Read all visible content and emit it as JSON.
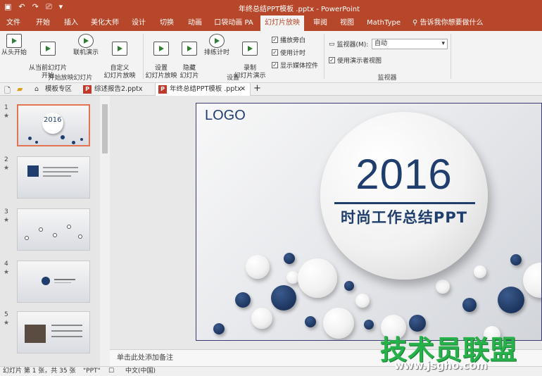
{
  "window": {
    "title": "年终总结PPT模板 .pptx  -  PowerPoint"
  },
  "menubar": {
    "tabs": [
      "文件",
      "开始",
      "插入",
      "美化大师",
      "设计",
      "切换",
      "动画",
      "口袋动画 PA",
      "幻灯片放映",
      "审阅",
      "视图",
      "MathType"
    ],
    "active_tab": "幻灯片放映",
    "tell_me": "告诉我你想要做什么"
  },
  "ribbon": {
    "btn_from_start": "从头开始",
    "btn_from_current": "从当前幻灯片\n开始",
    "btn_online": "联机演示",
    "btn_custom": "自定义\n幻灯片放映",
    "group_start": "开始放映幻灯片",
    "btn_setup": "设置\n幻灯片放映",
    "btn_hide": "隐藏\n幻灯片",
    "btn_rehearse": "排练计时",
    "btn_record": "录制\n幻灯片演示",
    "chk_play_narrations": "播放旁白",
    "chk_use_timings": "使用计时",
    "chk_show_media": "显示媒体控件",
    "group_setup": "设置",
    "monitor_label": "监视器(M):",
    "monitor_value": "自动",
    "chk_presenter_view": "使用演示者视图",
    "group_monitors": "监视器"
  },
  "file_tabs": [
    {
      "label": "模板专区"
    },
    {
      "label": "综述报告2.pptx"
    },
    {
      "label": "年终总结PPT模板 .pptx"
    }
  ],
  "thumbnails": [
    {
      "number": "1",
      "text": "2016"
    },
    {
      "number": "2",
      "text": ""
    },
    {
      "number": "3",
      "text": ""
    },
    {
      "number": "4",
      "text": ""
    },
    {
      "number": "5",
      "text": ""
    }
  ],
  "slide": {
    "logo": "LOGO",
    "year": "2016",
    "subtitle": "时尚工作总结PPT"
  },
  "notes": {
    "placeholder": "单击此处添加备注"
  },
  "status": {
    "slide_info": "幻灯片 第 1 张，共 35 张",
    "theme": "\"PPT\"",
    "language": "中文(中国)"
  },
  "watermark": {
    "text": "技术员联盟",
    "url": "www.jsgho.com"
  },
  "colors": {
    "accent": "#b7472a",
    "slide_navy": "#1f3e6e",
    "watermark_green": "#27b14a"
  }
}
